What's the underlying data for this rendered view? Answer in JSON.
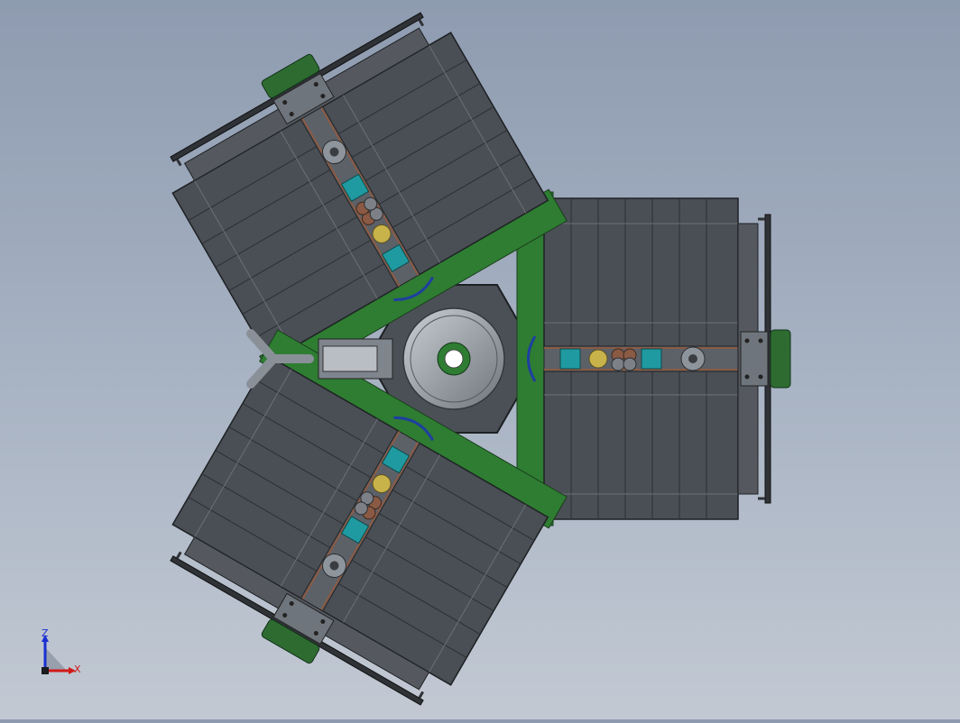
{
  "view": {
    "background_top": "#8e9bb0",
    "background_bottom": "#c2c9d3"
  },
  "model": {
    "frame_color": "#3f4347",
    "panel_color": "#4a4f55",
    "rib_color": "#5c6168",
    "accent_green": "#2e7d32",
    "accent_teal": "#1f9aa0",
    "accent_copper": "#8a5a44",
    "accent_blue": "#1e3fa0",
    "accent_yellow": "#c8b24a",
    "hub_color": "#9aa0a8"
  },
  "triad": {
    "z_label": "Z",
    "x_label": "X",
    "z_color": "#1a2fd0",
    "x_color": "#d01a1a"
  }
}
